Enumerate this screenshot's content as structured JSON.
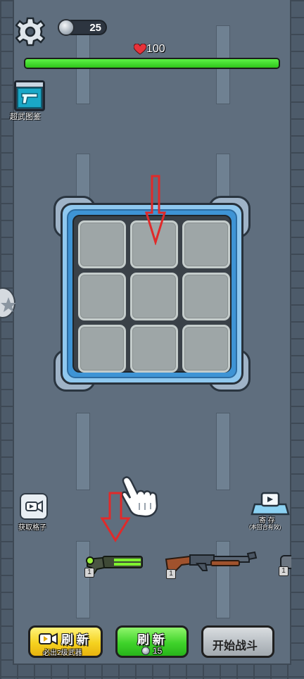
{
  "hud": {
    "coins": "25",
    "hp": "100",
    "hp_fraction": 1.0
  },
  "collection": {
    "label": "超武图鉴",
    "icon": "pistol-icon"
  },
  "board": {
    "rows": 3,
    "cols": 3,
    "cells": [
      "empty",
      "empty",
      "empty",
      "empty",
      "empty",
      "empty",
      "empty",
      "empty",
      "empty"
    ]
  },
  "side": {
    "get_grid_label": "获取格子",
    "storage_label": "寄 存",
    "storage_note": "(本回合有效)"
  },
  "weapons": [
    {
      "name": "plasma-rifle",
      "level": "1"
    },
    {
      "name": "shotgun",
      "level": "1"
    },
    {
      "name": "partial-weapon",
      "level": "1"
    }
  ],
  "buttons": {
    "ad_refresh_label": "刷 新",
    "ad_refresh_sub": "必出2级武器",
    "refresh_label": "刷 新",
    "refresh_cost": "15",
    "start_label": "开始战斗"
  },
  "colors": {
    "hp_green": "#3fd32a",
    "board_blue": "#3e94d5",
    "hint_red": "#e02a2a"
  }
}
